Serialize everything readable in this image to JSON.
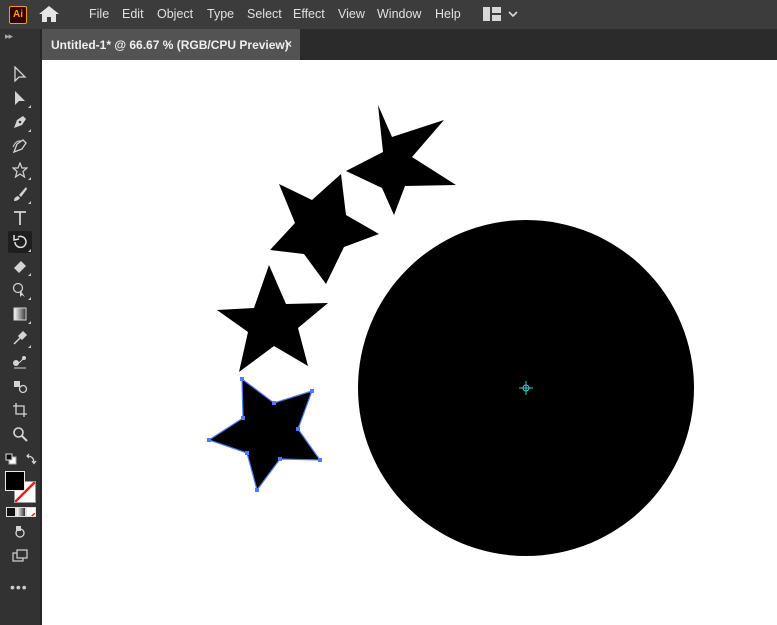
{
  "app": {
    "logo_text": "Ai",
    "home_icon": "home-icon"
  },
  "menu": [
    "File",
    "Edit",
    "Object",
    "Type",
    "Select",
    "Effect",
    "View",
    "Window",
    "Help"
  ],
  "workspace": {
    "icon": "workspace-switcher-icon",
    "chevron_icon": "chevron-down-icon"
  },
  "document": {
    "tab_title": "Untitled-1* @ 66.67 % (RGB/CPU Preview)",
    "close_glyph": "×"
  },
  "tools": [
    "selection-tool",
    "direct-selection-tool",
    "pen-tool",
    "curvature-tool",
    "star-tool",
    "paintbrush-tool",
    "type-tool",
    "rotate-tool",
    "eraser-tool",
    "shape-builder-tool",
    "gradient-tool",
    "eyedropper-tool",
    "blend-tool",
    "symbol-sprayer-tool",
    "artboard-tool",
    "zoom-tool"
  ],
  "active_tool": "rotate-tool",
  "colors": {
    "fill": "#000000",
    "stroke": "none",
    "selection": "#4f7bf5",
    "center_point": "#3fd0d0",
    "app_bg": "#323232",
    "menubar": "#3c3c3c",
    "canvas": "#ffffff"
  },
  "more_tools_glyph": "•••"
}
